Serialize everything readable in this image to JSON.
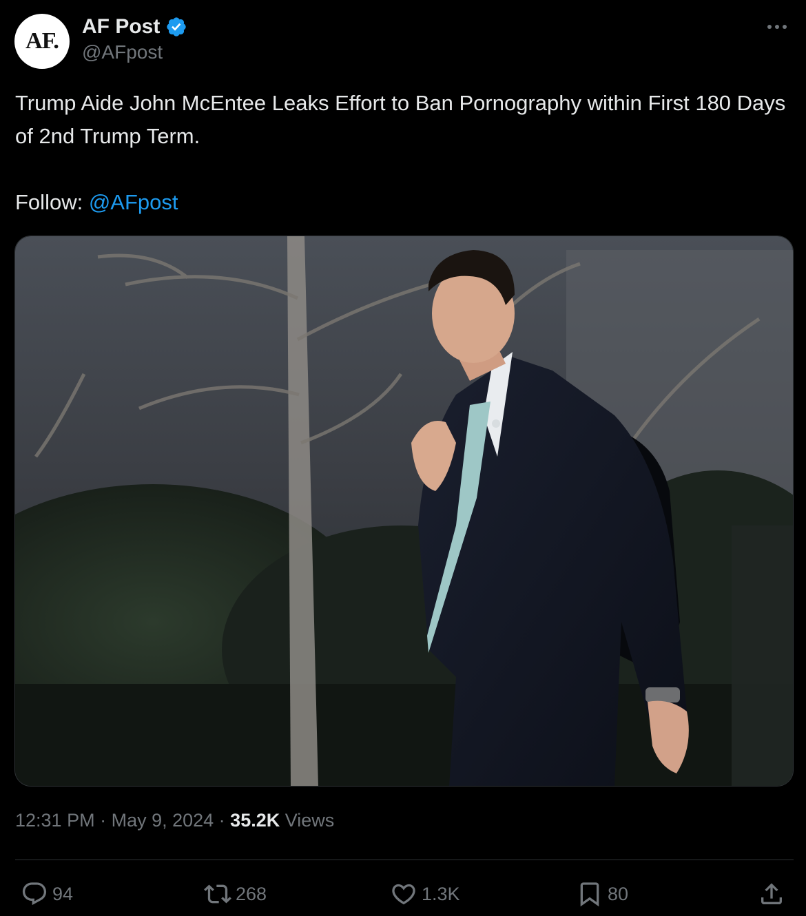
{
  "author": {
    "avatar_text": "AF.",
    "display_name": "AF Post",
    "handle": "@AFpost",
    "verified_icon": "verified-badge-icon"
  },
  "tweet": {
    "text": "Trump Aide John McEntee Leaks Effort to Ban Pornography within First 180 Days of 2nd Trump Term.",
    "follow_prefix": "Follow: ",
    "follow_mention": "@AFpost",
    "media_icon": "photo-man-in-suit-walking"
  },
  "meta": {
    "time": "12:31 PM",
    "separator": " · ",
    "date": "May 9, 2024",
    "views_count": "35.2K",
    "views_label": " Views"
  },
  "actions": {
    "replies": "94",
    "reposts": "268",
    "likes": "1.3K",
    "bookmarks": "80"
  },
  "colors": {
    "background": "#000000",
    "text": "#e7e9ea",
    "muted": "#71767b",
    "accent": "#1d9bf0",
    "divider": "#2f3336"
  }
}
